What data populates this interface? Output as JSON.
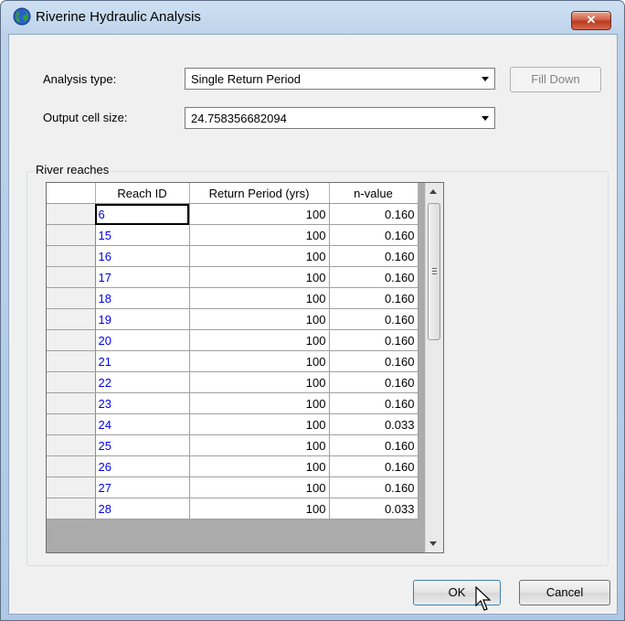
{
  "window": {
    "title": "Riverine Hydraulic Analysis",
    "close_label": "✕"
  },
  "form": {
    "analysis_type_label": "Analysis type:",
    "analysis_type_value": "Single Return Period",
    "output_cell_size_label": "Output cell size:",
    "output_cell_size_value": "24.758356682094",
    "fill_down_label": "Fill Down"
  },
  "reaches": {
    "group_label": "River reaches",
    "columns": [
      "Reach ID",
      "Return Period (yrs)",
      "n-value"
    ],
    "rows": [
      {
        "id": "6",
        "return_period": "100",
        "n_value": "0.160"
      },
      {
        "id": "15",
        "return_period": "100",
        "n_value": "0.160"
      },
      {
        "id": "16",
        "return_period": "100",
        "n_value": "0.160"
      },
      {
        "id": "17",
        "return_period": "100",
        "n_value": "0.160"
      },
      {
        "id": "18",
        "return_period": "100",
        "n_value": "0.160"
      },
      {
        "id": "19",
        "return_period": "100",
        "n_value": "0.160"
      },
      {
        "id": "20",
        "return_period": "100",
        "n_value": "0.160"
      },
      {
        "id": "21",
        "return_period": "100",
        "n_value": "0.160"
      },
      {
        "id": "22",
        "return_period": "100",
        "n_value": "0.160"
      },
      {
        "id": "23",
        "return_period": "100",
        "n_value": "0.160"
      },
      {
        "id": "24",
        "return_period": "100",
        "n_value": "0.033"
      },
      {
        "id": "25",
        "return_period": "100",
        "n_value": "0.160"
      },
      {
        "id": "26",
        "return_period": "100",
        "n_value": "0.160"
      },
      {
        "id": "27",
        "return_period": "100",
        "n_value": "0.160"
      },
      {
        "id": "28",
        "return_period": "100",
        "n_value": "0.033"
      }
    ]
  },
  "buttons": {
    "ok_label": "OK",
    "cancel_label": "Cancel"
  },
  "icons": {
    "app": "globe-icon",
    "cursor": "mouse-pointer-icon"
  }
}
